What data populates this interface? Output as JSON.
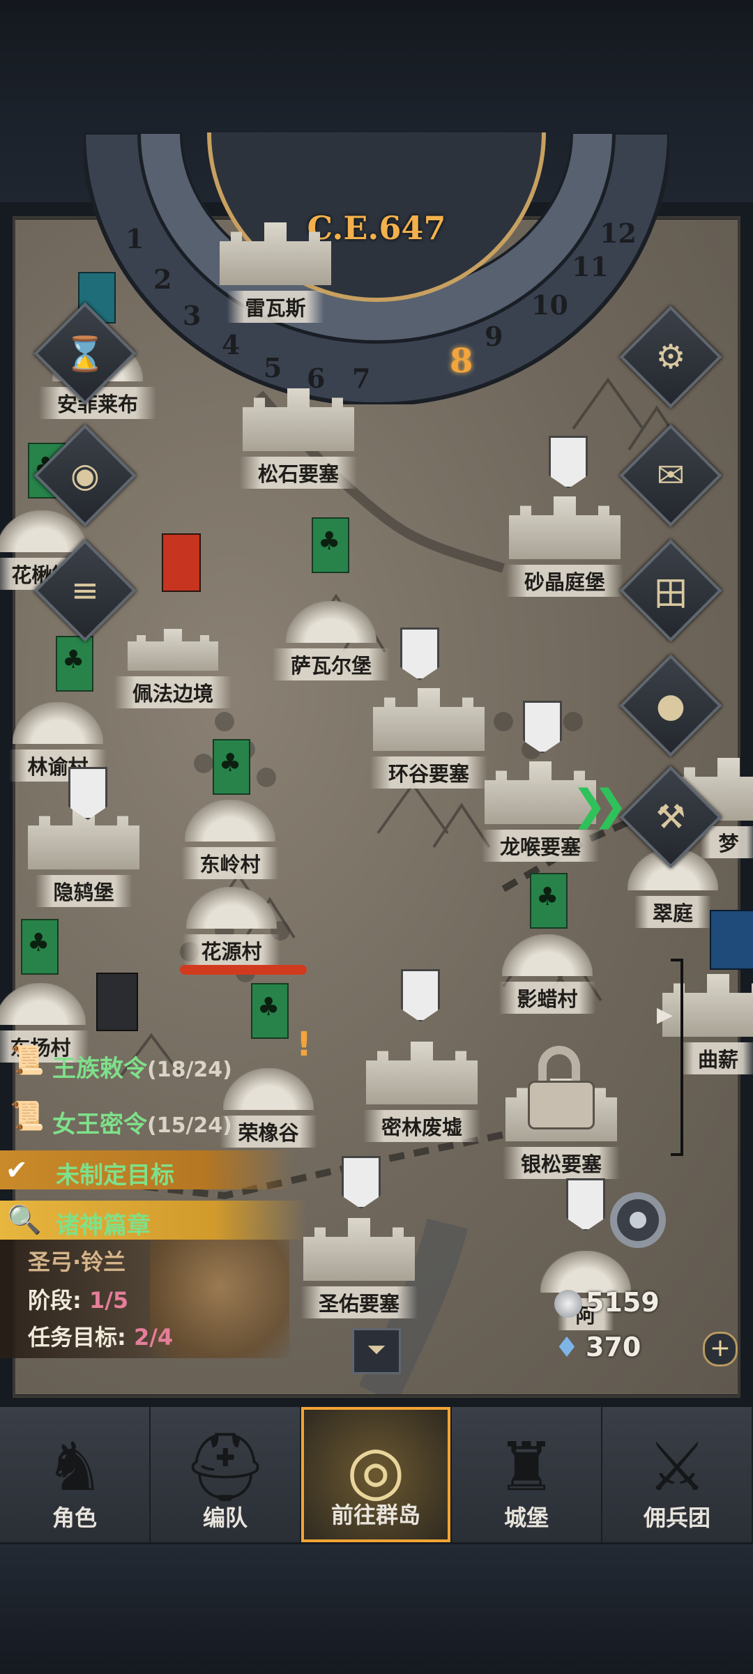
{
  "calendar": {
    "year": "C.E.647",
    "numbers": [
      "1",
      "2",
      "3",
      "4",
      "5",
      "6",
      "7",
      "8",
      "9",
      "10",
      "11",
      "12"
    ],
    "current": "8"
  },
  "places": [
    {
      "name": "松石要塞"
    },
    {
      "name": "砂晶庭堡"
    },
    {
      "name": "萨瓦尔堡"
    },
    {
      "name": "佩法边境"
    },
    {
      "name": "林谕村"
    },
    {
      "name": "环谷要塞"
    },
    {
      "name": "龙喉要塞"
    },
    {
      "name": "东岭村"
    },
    {
      "name": "隐鸫堡"
    },
    {
      "name": "花源村"
    },
    {
      "name": "翠庭"
    },
    {
      "name": "影蜡村"
    },
    {
      "name": "东扬村"
    },
    {
      "name": "曲薪"
    },
    {
      "name": "荣橡谷"
    },
    {
      "name": "密林废墟"
    },
    {
      "name": "银松要塞"
    },
    {
      "name": "圣佑要塞"
    },
    {
      "name": "安菲莱布"
    },
    {
      "name": "花楸镇"
    },
    {
      "name": "梦"
    },
    {
      "name": "雷瓦斯"
    },
    {
      "name": "阿"
    }
  ],
  "quests": {
    "royal": {
      "label": "王族敕令",
      "progress": "(18/24)"
    },
    "queen": {
      "label": "女王密令",
      "progress": "(15/24)"
    },
    "goal": {
      "label": "未制定目标"
    },
    "chapter": {
      "label": "诸神篇章"
    },
    "hero": "圣弓·铃兰",
    "stage_label": "阶段: ",
    "stage_value": "1/5",
    "target_label": "任务目标: ",
    "target_value": "2/4"
  },
  "currency": {
    "silver": "5159",
    "crystal": "370"
  },
  "side_icons": [
    "hourglass-icon",
    "money-bag-icon",
    "scroll-icon",
    "gear-icon",
    "mail-icon",
    "grid-icon",
    "coin-icon",
    "hammer-icon"
  ],
  "nav": [
    {
      "label": "角色",
      "icon": "knight-icon"
    },
    {
      "label": "编队",
      "icon": "helmet-icon"
    },
    {
      "label": "前往群岛",
      "icon": "compass-globe-icon",
      "active": true
    },
    {
      "label": "城堡",
      "icon": "castle-icon"
    },
    {
      "label": "佣兵团",
      "icon": "mercenary-icon"
    }
  ],
  "colors": {
    "accent": "#f2a435",
    "quest_green": "#7fe08a",
    "map": "#776e62"
  }
}
